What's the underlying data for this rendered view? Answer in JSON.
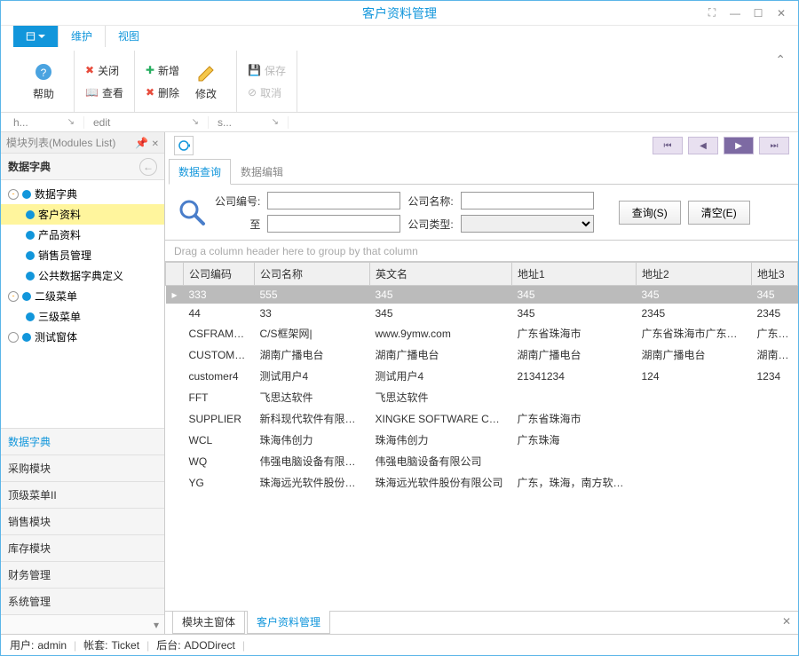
{
  "window": {
    "title": "客户资料管理"
  },
  "ribbon": {
    "tabs": {
      "maintain": "维护",
      "view": "视图"
    },
    "help": "帮助",
    "close": "关闭",
    "view_btn": "查看",
    "new": "新增",
    "delete": "删除",
    "modify": "修改",
    "save": "保存",
    "cancel": "取消",
    "footer": {
      "g1": "h...",
      "g2": "edit",
      "g3": "s..."
    }
  },
  "left": {
    "header": "模块列表(Modules List)",
    "section": "数据字典",
    "tree": [
      {
        "label": "数据字典",
        "level": 1,
        "toggle": "-"
      },
      {
        "label": "客户资料",
        "level": 2,
        "selected": true
      },
      {
        "label": "产品资料",
        "level": 2
      },
      {
        "label": "销售员管理",
        "level": 2
      },
      {
        "label": "公共数据字典定义",
        "level": 2
      },
      {
        "label": "二级菜单",
        "level": 1,
        "toggle": "-"
      },
      {
        "label": "三级菜单",
        "level": 2
      },
      {
        "label": "测试窗体",
        "level": 1,
        "toggle": ""
      }
    ],
    "accordion": [
      "数据字典",
      "采购模块",
      "顶级菜单II",
      "销售模块",
      "库存模块",
      "财务管理",
      "系统管理"
    ]
  },
  "right": {
    "tabs": {
      "query": "数据查询",
      "edit": "数据编辑"
    },
    "search": {
      "lbl_code": "公司编号:",
      "lbl_name": "公司名称:",
      "lbl_to": "至",
      "lbl_type": "公司类型:",
      "btn_query": "查询(S)",
      "btn_clear": "清空(E)"
    },
    "group_hint": "Drag a column header here to group by that column",
    "columns": [
      "公司编码",
      "公司名称",
      "英文名",
      "地址1",
      "地址2",
      "地址3"
    ],
    "rows": [
      {
        "c": [
          "333",
          "555",
          "345",
          "345",
          "345",
          "345"
        ],
        "sel": true
      },
      {
        "c": [
          "44",
          "33",
          "345",
          "345",
          "2345",
          "2345"
        ]
      },
      {
        "c": [
          "CSFRAMEW...",
          "C/S框架网|",
          "www.9ymw.com",
          "广东省珠海市",
          "广东省珠海市广东省珠海市",
          "广东省珠海"
        ]
      },
      {
        "c": [
          "CUSTOMER",
          "湖南广播电台",
          "湖南广播电台",
          "湖南广播电台",
          "湖南广播电台",
          "湖南广播电"
        ]
      },
      {
        "c": [
          "customer4",
          "测试用户4",
          "测试用户4",
          "21341234",
          "124",
          "1234"
        ]
      },
      {
        "c": [
          "FFT",
          "飞思达软件",
          "飞思达软件",
          "",
          "",
          ""
        ]
      },
      {
        "c": [
          "SUPPLIER",
          "新科现代软件有限公司",
          "XINGKE SOFTWARE COMP...",
          "广东省珠海市",
          "",
          ""
        ]
      },
      {
        "c": [
          "WCL",
          "珠海伟创力",
          "珠海伟创力",
          "广东珠海",
          "",
          ""
        ]
      },
      {
        "c": [
          "WQ",
          "伟强电脑设备有限公司",
          "伟强电脑设备有限公司",
          "",
          "",
          ""
        ]
      },
      {
        "c": [
          "YG",
          "珠海远光软件股份有限公司",
          "珠海远光软件股份有限公司",
          "广东，珠海，南方软件园",
          "",
          ""
        ]
      }
    ],
    "bottom_tabs": {
      "main": "模块主窗体",
      "current": "客户资料管理"
    }
  },
  "status": {
    "user_lbl": "用户:",
    "user": "admin",
    "acct_lbl": "帐套:",
    "acct": "Ticket",
    "back_lbl": "后台:",
    "back": "ADODirect"
  }
}
